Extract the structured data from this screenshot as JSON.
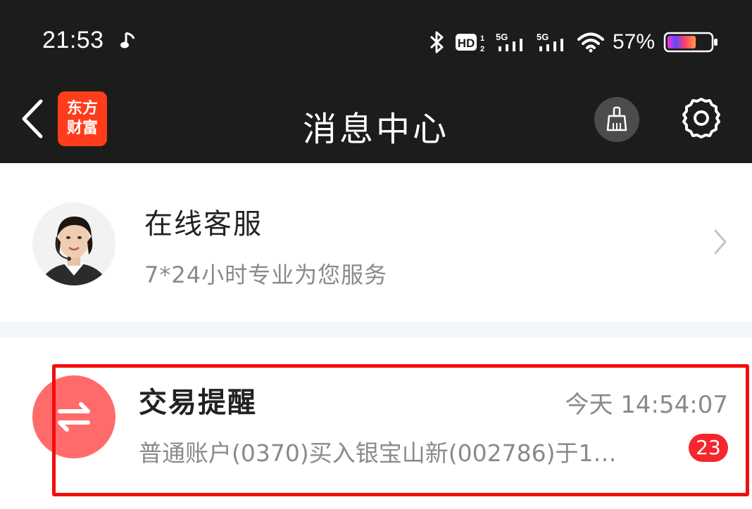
{
  "status_bar": {
    "time": "21:53",
    "battery_percent": "57%",
    "signal_labels": [
      "5G",
      "5G"
    ],
    "hd_label": "HD"
  },
  "nav": {
    "logo_line1": "东方",
    "logo_line2": "财富",
    "title": "消息中心"
  },
  "service": {
    "title": "在线客服",
    "subtitle": "7*24小时专业为您服务"
  },
  "trade": {
    "title": "交易提醒",
    "time": "今天 14:54:07",
    "preview": "普通账户(0370)买入银宝山新(002786)于1…",
    "badge": "23"
  },
  "colors": {
    "topbar": "#1b1c1b",
    "logo": "#ff3c1c",
    "trade_icon": "#ff6b6b",
    "badge": "#f5262d",
    "highlight": "#f20d0d"
  }
}
